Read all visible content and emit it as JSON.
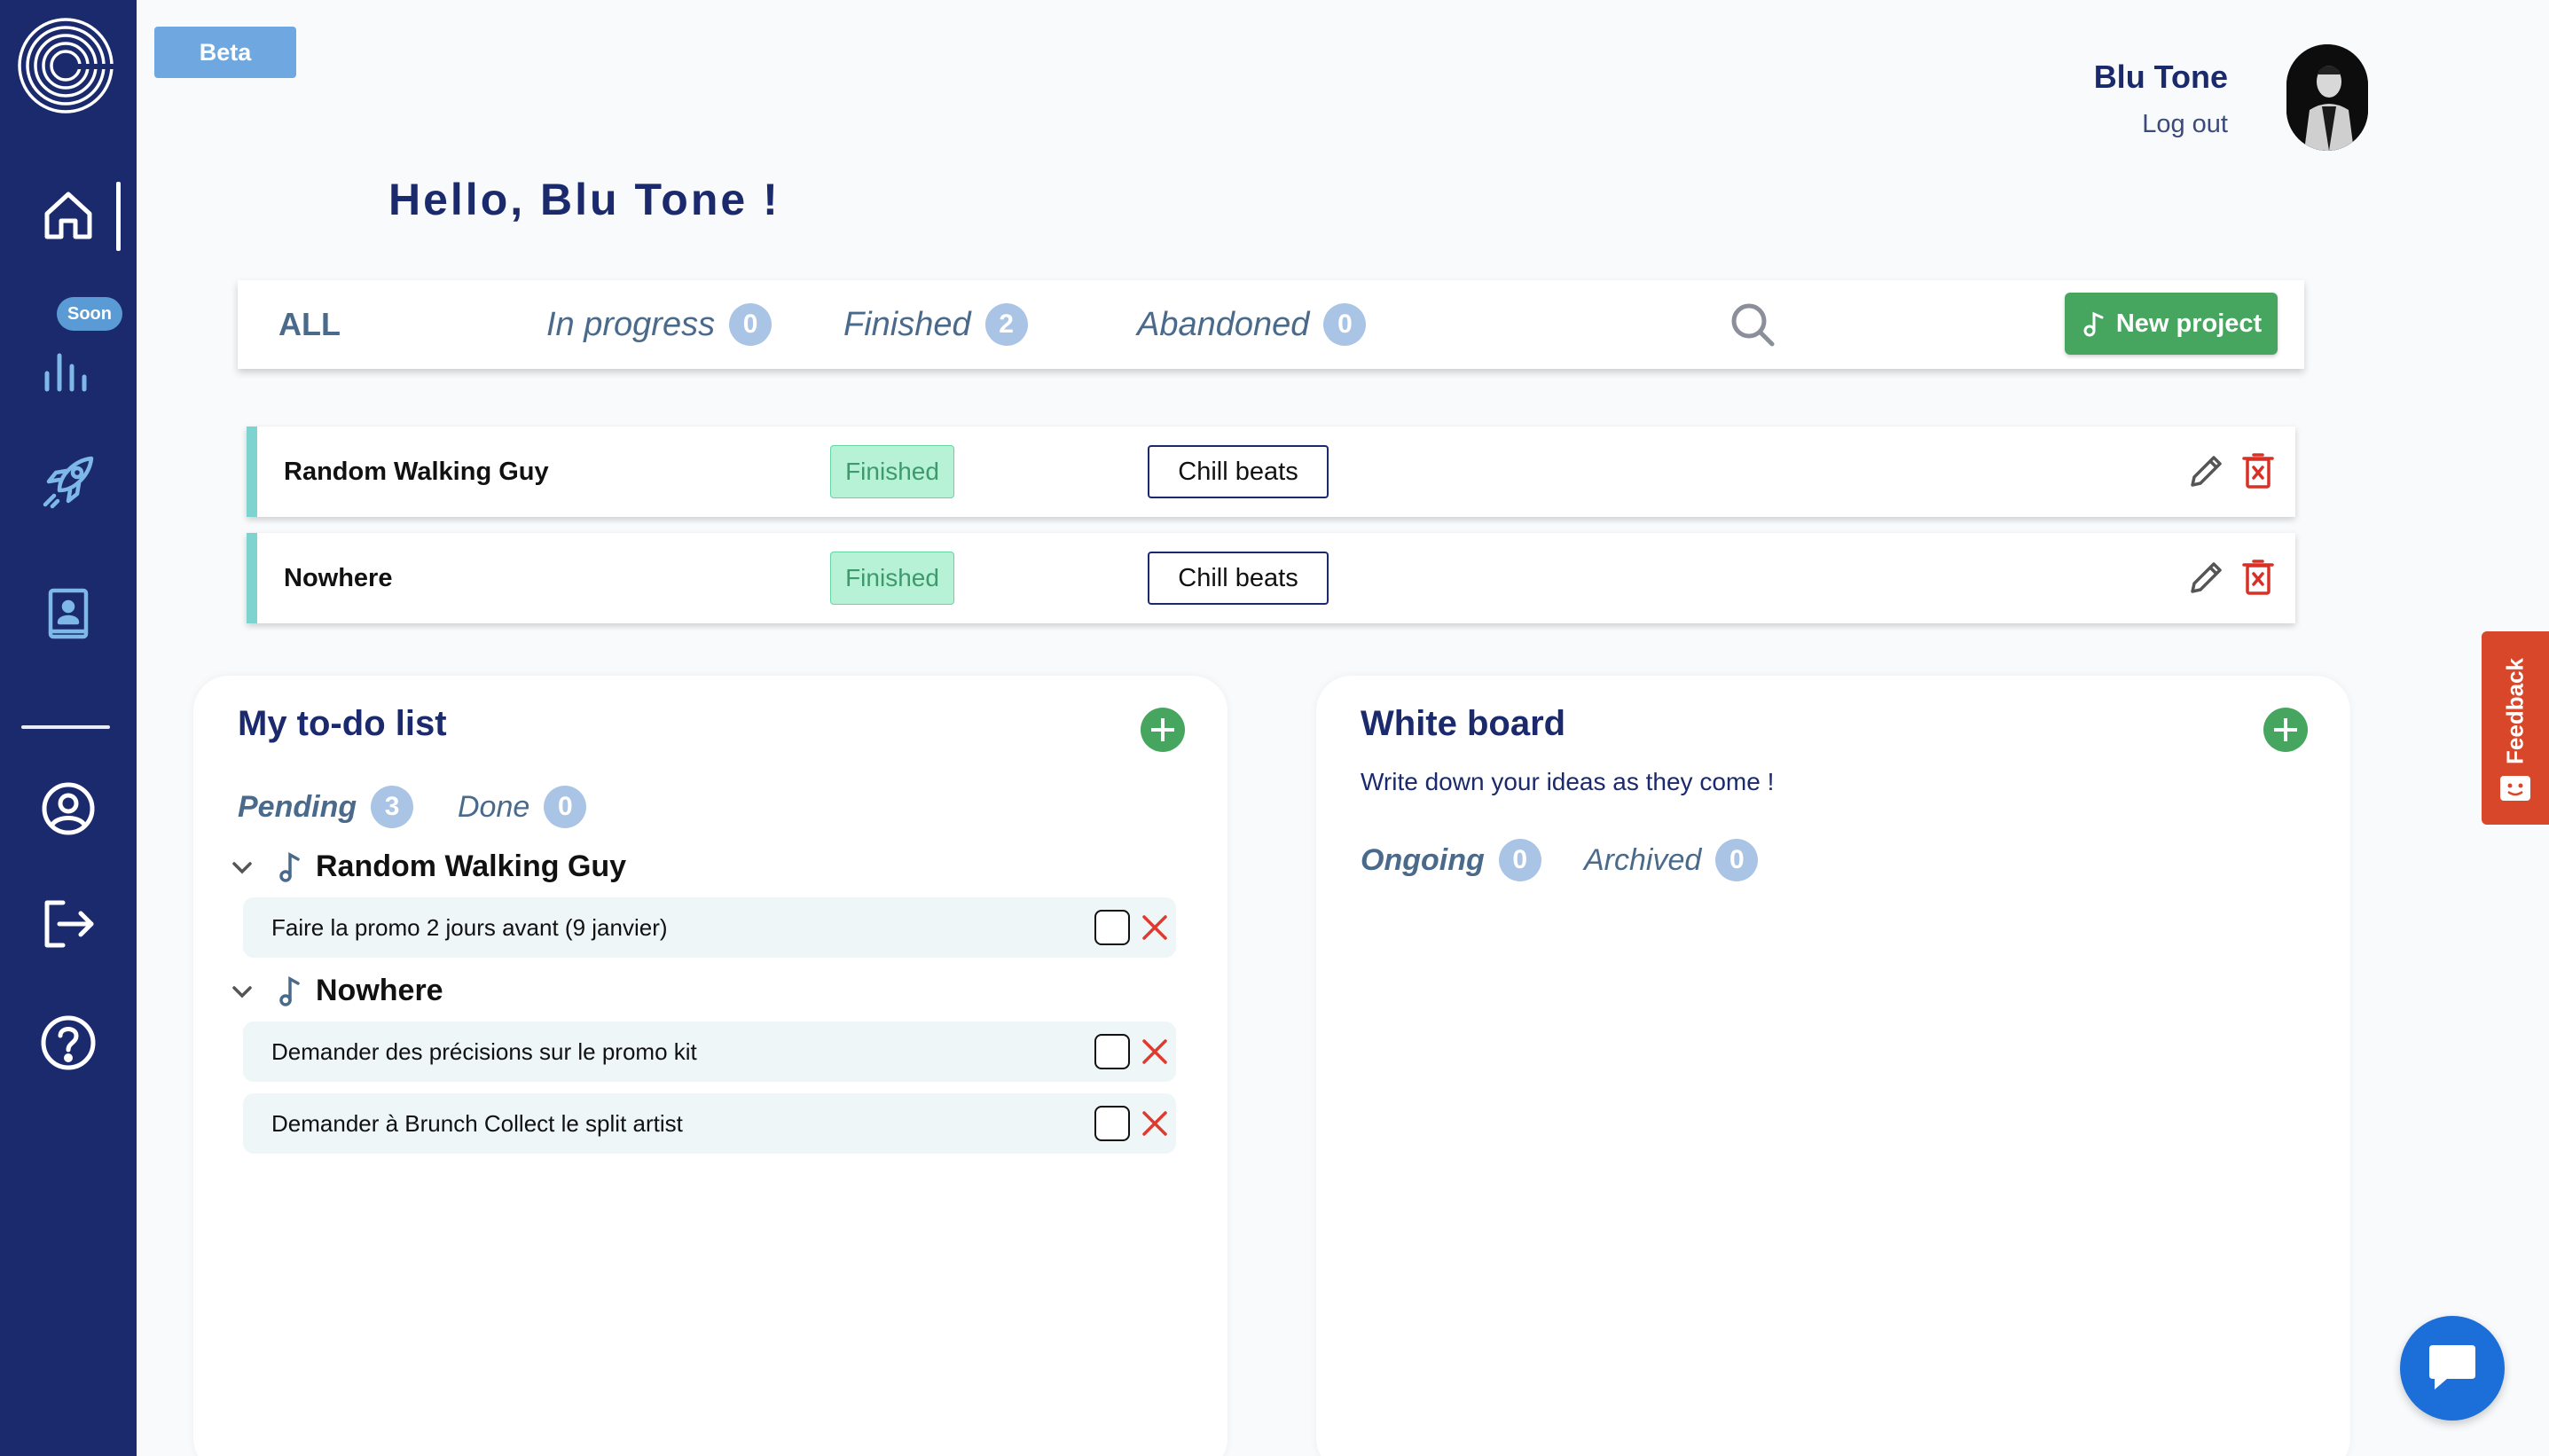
{
  "sidebar": {
    "soon_badge": "Soon",
    "items": [
      {
        "name": "home-icon"
      },
      {
        "name": "stats-icon"
      },
      {
        "name": "rocket-icon"
      },
      {
        "name": "contacts-icon"
      },
      {
        "name": "profile-icon"
      },
      {
        "name": "logout-icon"
      },
      {
        "name": "help-icon"
      }
    ]
  },
  "header": {
    "beta": "Beta",
    "user_name": "Blu Tone",
    "logout": "Log out",
    "greeting": "Hello, Blu Tone !"
  },
  "filters": {
    "all": "ALL",
    "in_progress": {
      "label": "In progress",
      "count": "0"
    },
    "finished": {
      "label": "Finished",
      "count": "2"
    },
    "abandoned": {
      "label": "Abandoned",
      "count": "0"
    },
    "new_project": "New project"
  },
  "projects": [
    {
      "name": "Random Walking Guy",
      "status": "Finished",
      "genre": "Chill beats"
    },
    {
      "name": "Nowhere",
      "status": "Finished",
      "genre": "Chill beats"
    }
  ],
  "todo": {
    "title": "My to-do list",
    "tabs": {
      "pending": {
        "label": "Pending",
        "count": "3"
      },
      "done": {
        "label": "Done",
        "count": "0"
      }
    },
    "groups": [
      {
        "project": "Random Walking Guy",
        "items": [
          "Faire la promo 2 jours avant (9 janvier)"
        ]
      },
      {
        "project": "Nowhere",
        "items": [
          "Demander des précisions sur le promo kit",
          "Demander à Brunch Collect le split artist"
        ]
      }
    ]
  },
  "whiteboard": {
    "title": "White board",
    "subtitle": "Write down your ideas as they come !",
    "tabs": {
      "ongoing": {
        "label": "Ongoing",
        "count": "0"
      },
      "archived": {
        "label": "Archived",
        "count": "0"
      }
    }
  },
  "feedback": "Feedback",
  "colors": {
    "sidebar": "#1a2a6c",
    "accent_green": "#46a65f",
    "teal_border": "#7dd3cf",
    "delete_red": "#d93025",
    "feedback": "#d9472b"
  }
}
